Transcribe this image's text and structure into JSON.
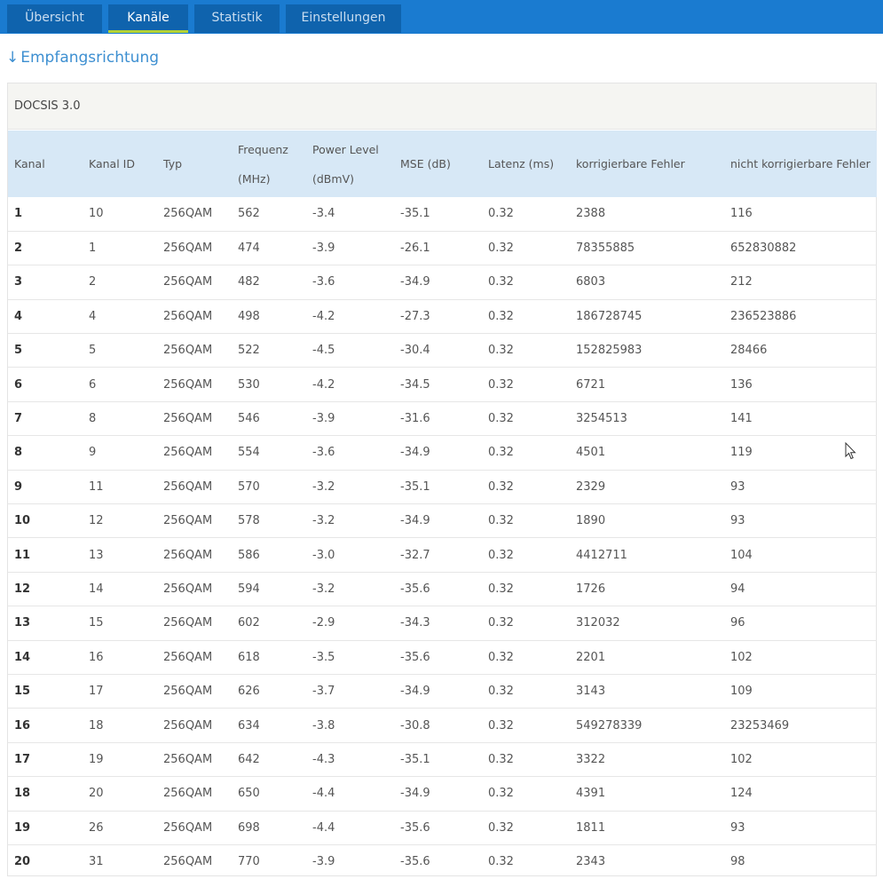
{
  "tabs": [
    {
      "label": "Übersicht",
      "active": false
    },
    {
      "label": "Kanäle",
      "active": true
    },
    {
      "label": "Statistik",
      "active": false
    },
    {
      "label": "Einstellungen",
      "active": false
    }
  ],
  "section": {
    "arrow": "↓",
    "title": "Empfangsrichtung"
  },
  "panel": {
    "title": "DOCSIS 3.0"
  },
  "table": {
    "headers": [
      {
        "line1": "Kanal",
        "line2": ""
      },
      {
        "line1": "Kanal ID",
        "line2": ""
      },
      {
        "line1": "Typ",
        "line2": ""
      },
      {
        "line1": "Frequenz",
        "line2": "(MHz)"
      },
      {
        "line1": "Power Level",
        "line2": "(dBmV)"
      },
      {
        "line1": "MSE (dB)",
        "line2": ""
      },
      {
        "line1": "Latenz (ms)",
        "line2": ""
      },
      {
        "line1": "korrigierbare Fehler",
        "line2": ""
      },
      {
        "line1": "nicht korrigierbare Fehler",
        "line2": ""
      }
    ],
    "rows": [
      [
        "1",
        "10",
        "256QAM",
        "562",
        "-3.4",
        "-35.1",
        "0.32",
        "2388",
        "116"
      ],
      [
        "2",
        "1",
        "256QAM",
        "474",
        "-3.9",
        "-26.1",
        "0.32",
        "78355885",
        "652830882"
      ],
      [
        "3",
        "2",
        "256QAM",
        "482",
        "-3.6",
        "-34.9",
        "0.32",
        "6803",
        "212"
      ],
      [
        "4",
        "4",
        "256QAM",
        "498",
        "-4.2",
        "-27.3",
        "0.32",
        "186728745",
        "236523886"
      ],
      [
        "5",
        "5",
        "256QAM",
        "522",
        "-4.5",
        "-30.4",
        "0.32",
        "152825983",
        "28466"
      ],
      [
        "6",
        "6",
        "256QAM",
        "530",
        "-4.2",
        "-34.5",
        "0.32",
        "6721",
        "136"
      ],
      [
        "7",
        "8",
        "256QAM",
        "546",
        "-3.9",
        "-31.6",
        "0.32",
        "3254513",
        "141"
      ],
      [
        "8",
        "9",
        "256QAM",
        "554",
        "-3.6",
        "-34.9",
        "0.32",
        "4501",
        "119"
      ],
      [
        "9",
        "11",
        "256QAM",
        "570",
        "-3.2",
        "-35.1",
        "0.32",
        "2329",
        "93"
      ],
      [
        "10",
        "12",
        "256QAM",
        "578",
        "-3.2",
        "-34.9",
        "0.32",
        "1890",
        "93"
      ],
      [
        "11",
        "13",
        "256QAM",
        "586",
        "-3.0",
        "-32.7",
        "0.32",
        "4412711",
        "104"
      ],
      [
        "12",
        "14",
        "256QAM",
        "594",
        "-3.2",
        "-35.6",
        "0.32",
        "1726",
        "94"
      ],
      [
        "13",
        "15",
        "256QAM",
        "602",
        "-2.9",
        "-34.3",
        "0.32",
        "312032",
        "96"
      ],
      [
        "14",
        "16",
        "256QAM",
        "618",
        "-3.5",
        "-35.6",
        "0.32",
        "2201",
        "102"
      ],
      [
        "15",
        "17",
        "256QAM",
        "626",
        "-3.7",
        "-34.9",
        "0.32",
        "3143",
        "109"
      ],
      [
        "16",
        "18",
        "256QAM",
        "634",
        "-3.8",
        "-30.8",
        "0.32",
        "549278339",
        "23253469"
      ],
      [
        "17",
        "19",
        "256QAM",
        "642",
        "-4.3",
        "-35.1",
        "0.32",
        "3322",
        "102"
      ],
      [
        "18",
        "20",
        "256QAM",
        "650",
        "-4.4",
        "-34.9",
        "0.32",
        "4391",
        "124"
      ],
      [
        "19",
        "26",
        "256QAM",
        "698",
        "-4.4",
        "-35.6",
        "0.32",
        "1811",
        "93"
      ],
      [
        "20",
        "31",
        "256QAM",
        "770",
        "-3.9",
        "-35.6",
        "0.32",
        "2343",
        "98"
      ]
    ]
  },
  "colors": {
    "tabbar": "#1a7bd0",
    "tab": "#0f63ad",
    "active_underline": "#b5d334",
    "link": "#3d8fd1",
    "header_bg": "#d7e8f6"
  }
}
